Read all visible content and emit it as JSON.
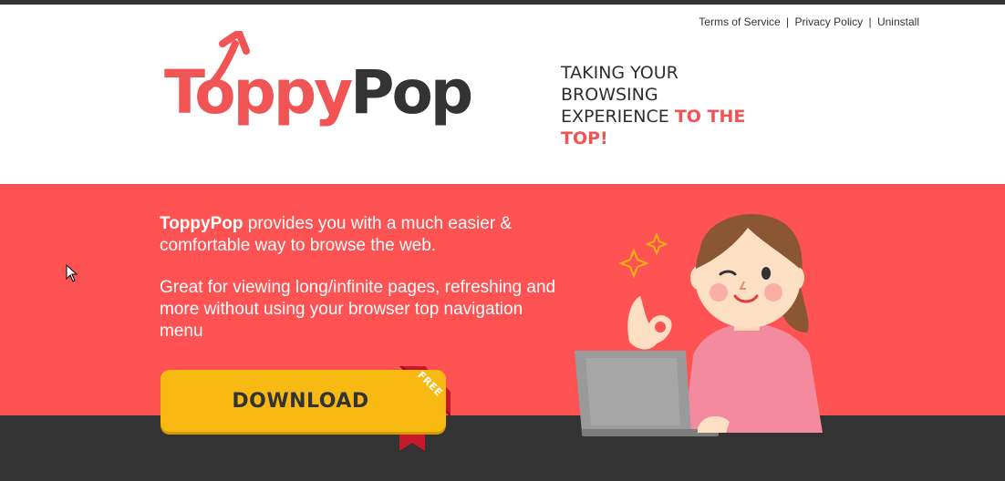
{
  "header": {
    "links": [
      {
        "label": "Terms of Service"
      },
      {
        "label": "Privacy Policy"
      },
      {
        "label": "Uninstall"
      }
    ],
    "separator": "|"
  },
  "logo": {
    "part1": "Toppy",
    "part2": "Pop",
    "icon": "up-arrow-icon"
  },
  "tagline": {
    "line1": "Taking your",
    "line2": "browsing",
    "line3": "experience",
    "accent": "to the top!"
  },
  "hero": {
    "brand": "ToppyPop",
    "intro_rest": " provides you with a much easier & comfortable way to browse the web.",
    "paragraph2": "Great for viewing long/infinite pages, refreshing and more without using your browser top navigation menu",
    "download_label": "DOWNLOAD",
    "ribbon_label": "FREE"
  },
  "colors": {
    "accent_red": "#ff5253",
    "brand_red": "#f05454",
    "dark": "#333333",
    "button_yellow": "#f8b912"
  }
}
